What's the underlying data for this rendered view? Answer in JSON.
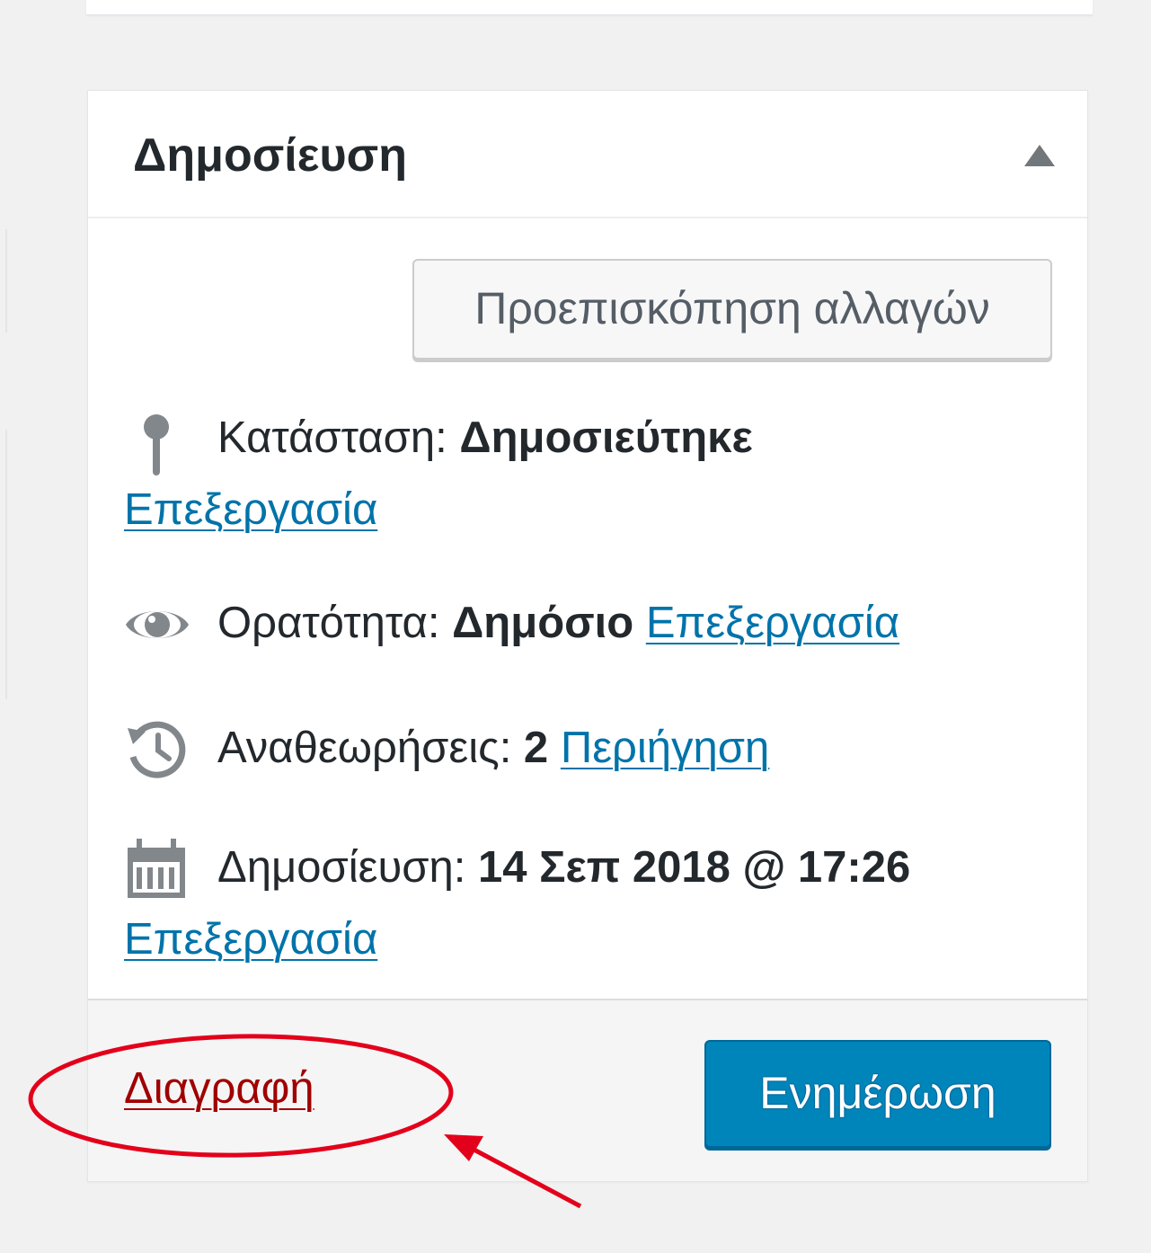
{
  "publish_box": {
    "title": "Δημοσίευση",
    "preview_button": "Προεπισκόπηση αλλαγών",
    "status": {
      "label": "Κατάσταση: ",
      "value": "Δημοσιεύτηκε",
      "link": "Επεξεργασία",
      "icon": "pin-icon"
    },
    "visibility": {
      "label": "Ορατότητα: ",
      "value": "Δημόσιο",
      "link": "Επεξεργασία",
      "icon": "eye-icon"
    },
    "revisions": {
      "label": "Αναθεωρήσεις: ",
      "value": "2",
      "link": "Περιήγηση",
      "icon": "history-icon"
    },
    "published_on": {
      "label": "Δημοσίευση: ",
      "value": "14 Σεπ 2018 @ 17:26",
      "link": "Επεξεργασία",
      "icon": "calendar-icon"
    },
    "delete_link": "Διαγραφή",
    "update_button": "Ενημέρωση"
  },
  "colors": {
    "link": "#0073aa",
    "delete": "#a00000",
    "primary_button": "#0085ba",
    "annotation": "#e3001b"
  }
}
